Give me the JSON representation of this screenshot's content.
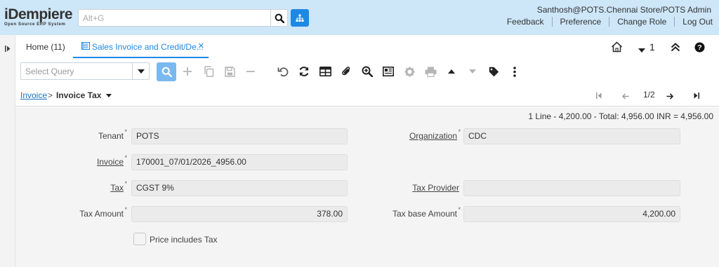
{
  "header": {
    "logo_main": "iDempiere",
    "logo_sub": "Open Source ERP System",
    "search_placeholder": "Alt+G",
    "user": "Santhosh@POTS.Chennai Store/POTS Admin",
    "links": [
      "Feedback",
      "Preference",
      "Change Role",
      "Log Out"
    ]
  },
  "tabs": {
    "home": "Home (11)",
    "active": "Sales Invoice and Credit/De...",
    "close": "×",
    "window_count": "1"
  },
  "toolbar": {
    "query_placeholder": "Select Query",
    "icons": [
      "search-icon",
      "new-icon",
      "copy-icon",
      "save-icon",
      "delete-icon",
      "undo-icon",
      "refresh-icon",
      "grid-toggle-icon",
      "attachment-icon",
      "zoom-icon",
      "report-icon",
      "process-icon",
      "print-icon",
      "parent-record-icon",
      "detail-record-icon",
      "tag-icon",
      "more-icon"
    ]
  },
  "breadcrumb": {
    "parent": "Invoice",
    "separator": ">",
    "current": "Invoice Tax",
    "page": "1/2"
  },
  "summary": "1 Line - 4,200.00 - Total: 4,956.00 INR = 4,956.00",
  "form": {
    "tenant_label": "Tenant",
    "tenant_value": "POTS",
    "organization_label": "Organization",
    "organization_value": "CDC",
    "invoice_label": "Invoice",
    "invoice_value": "170001_07/01/2026_4956.00",
    "tax_label": "Tax",
    "tax_value": "CGST 9%",
    "tax_provider_label": "Tax Provider",
    "tax_provider_value": "",
    "tax_amount_label": "Tax Amount",
    "tax_amount_value": "378.00",
    "tax_base_label": "Tax base Amount",
    "tax_base_value": "4,200.00",
    "price_includes_tax_label": "Price includes Tax",
    "price_includes_tax_checked": false
  },
  "colors": {
    "header_bg": "#cde6f8",
    "accent": "#1e88e5",
    "content_bg": "#f4f4f4",
    "field_bg": "#ebebeb"
  }
}
